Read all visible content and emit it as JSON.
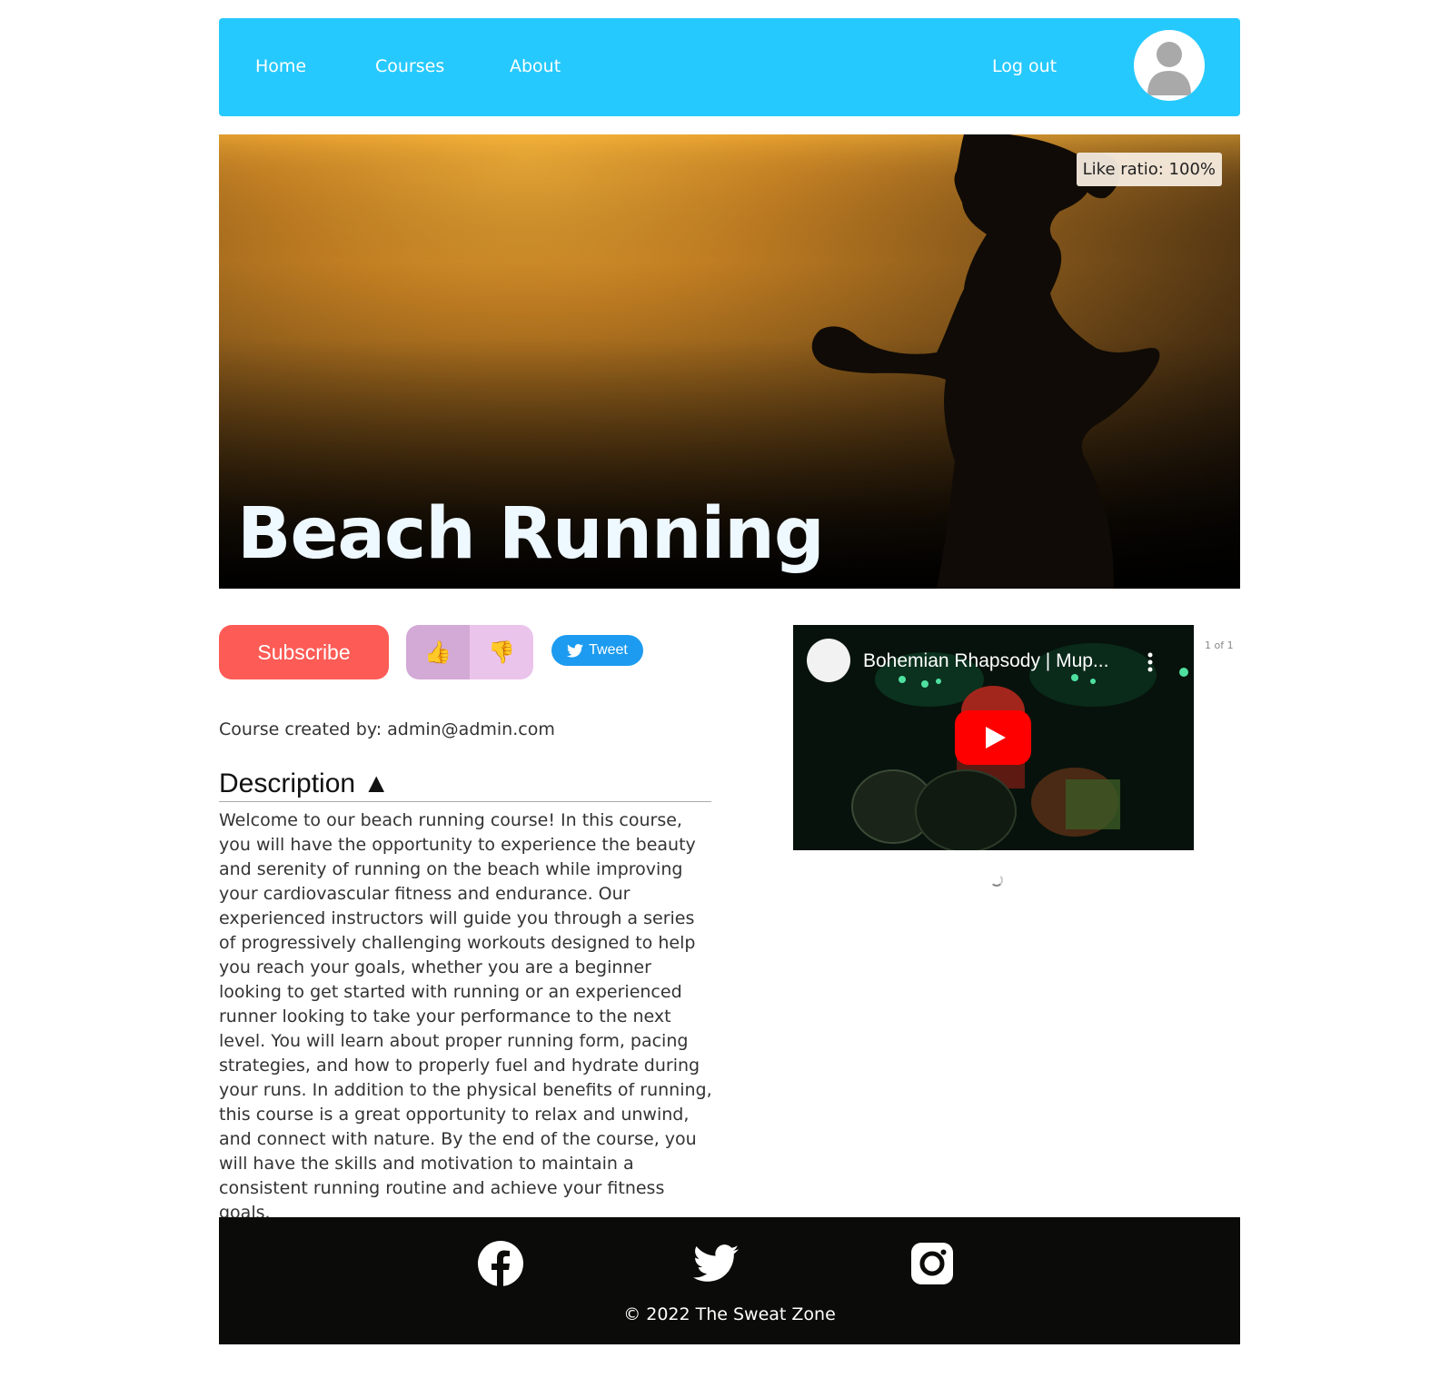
{
  "nav": {
    "home": "Home",
    "courses": "Courses",
    "about": "About",
    "logout": "Log out"
  },
  "course": {
    "title": "Beach Running",
    "like_ratio": "Like ratio: 100%",
    "subscribe_label": "Subscribe",
    "creator": "Course created by: admin@admin.com",
    "description_heading": "Description ▲",
    "description": "Welcome to our beach running course! In this course, you will have the opportunity to experience the beauty and serenity of running on the beach while improving your cardiovascular fitness and endurance. Our experienced instructors will guide you through a series of progressively challenging workouts designed to help you reach your goals, whether you are a beginner looking to get started with running or an experienced runner looking to take your performance to the next level. You will learn about proper running form, pacing strategies, and how to properly fuel and hydrate during your runs. In addition to the physical benefits of running, this course is a great opportunity to relax and unwind, and connect with nature. By the end of the course, you will have the skills and motivation to maintain a consistent running routine and achieve your fitness goals."
  },
  "social_share": {
    "tweet_label": "Tweet"
  },
  "video": {
    "title": "Bohemian Rhapsody | Mup...",
    "pager": "1 of 1"
  },
  "footer": {
    "copyright": "© 2022 The Sweat Zone",
    "icons": [
      "facebook-icon",
      "twitter-icon",
      "instagram-icon"
    ]
  },
  "colors": {
    "nav": "#26c9fd",
    "subscribe": "#fd5b55",
    "like": "#d3a9d6",
    "dislike": "#ebc4ec",
    "tweet": "#1d9bf0",
    "footer": "#0b0c09"
  }
}
